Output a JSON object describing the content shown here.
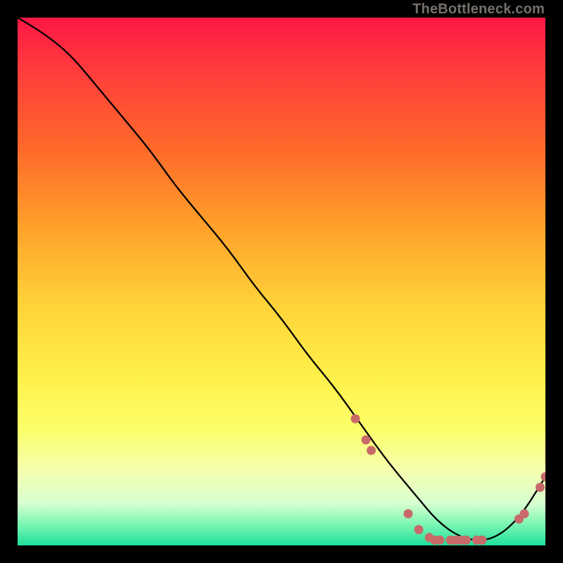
{
  "watermark": "TheBottleneck.com",
  "chart_data": {
    "type": "line",
    "title": "",
    "xlabel": "",
    "ylabel": "",
    "xlim": [
      0,
      100
    ],
    "ylim": [
      0,
      100
    ],
    "x": [
      0,
      5,
      10,
      15,
      20,
      25,
      30,
      35,
      40,
      45,
      50,
      55,
      60,
      65,
      70,
      75,
      80,
      85,
      90,
      95,
      100
    ],
    "values": [
      100,
      97,
      93,
      87,
      81,
      75,
      68,
      62,
      56,
      49,
      43,
      36,
      30,
      23,
      16,
      10,
      4,
      1,
      1,
      5,
      13
    ],
    "markers": [
      {
        "x": 64,
        "y": 24
      },
      {
        "x": 66,
        "y": 20
      },
      {
        "x": 67,
        "y": 18
      },
      {
        "x": 74,
        "y": 6
      },
      {
        "x": 76,
        "y": 3
      },
      {
        "x": 78,
        "y": 1.5
      },
      {
        "x": 79,
        "y": 1
      },
      {
        "x": 80,
        "y": 1
      },
      {
        "x": 82,
        "y": 1
      },
      {
        "x": 83,
        "y": 1
      },
      {
        "x": 84,
        "y": 1
      },
      {
        "x": 85,
        "y": 1
      },
      {
        "x": 87,
        "y": 1
      },
      {
        "x": 88,
        "y": 1
      },
      {
        "x": 95,
        "y": 5
      },
      {
        "x": 96,
        "y": 6
      },
      {
        "x": 99,
        "y": 11
      },
      {
        "x": 100,
        "y": 13
      }
    ],
    "colors": {
      "line": "#000000",
      "marker": "#c96a6a",
      "gradient_top": "#ff1744",
      "gradient_bottom": "#1ee09a"
    }
  }
}
